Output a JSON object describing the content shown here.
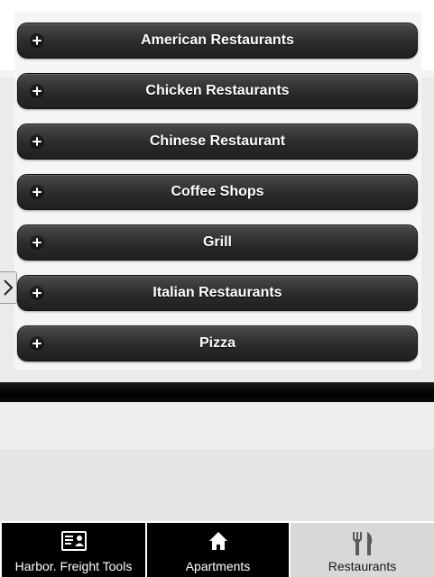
{
  "categories": [
    {
      "label": "American Restaurants"
    },
    {
      "label": "Chicken Restaurants"
    },
    {
      "label": "Chinese Restaurant"
    },
    {
      "label": "Coffee Shops"
    },
    {
      "label": "Grill"
    },
    {
      "label": "Italian Restaurants"
    },
    {
      "label": "Pizza"
    }
  ],
  "icons": {
    "expand": "plus-circle-icon",
    "side_tab": "chevron-right-icon"
  },
  "tabbar": {
    "tabs": [
      {
        "label": "Harbor. Freight Tools",
        "icon": "id-card-icon"
      },
      {
        "label": "Apartments",
        "icon": "home-icon"
      },
      {
        "label": "Restaurants",
        "icon": "fork-knife-icon",
        "active": true
      }
    ]
  },
  "colors": {
    "button_dark": "#2b2b2b",
    "tab_bg": "#000000",
    "tab_active_bg": "#d8d8d8"
  }
}
